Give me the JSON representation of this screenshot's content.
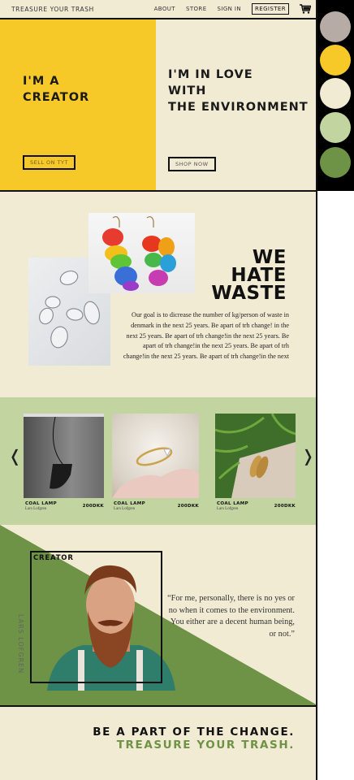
{
  "nav": {
    "brand": "TREASURE YOUR TRASH",
    "links": [
      "ABOUT",
      "STORE",
      "SIGN IN"
    ],
    "register": "REGISTER",
    "cart_icon": "cart-icon"
  },
  "hero": {
    "left": {
      "line1": "I'M A",
      "line2": "CREATOR",
      "button": "SELL ON TYT"
    },
    "right": {
      "line1": "I'M IN LOVE",
      "line2": "WITH",
      "line3": "THE ENVIRONMENT",
      "button": "SHOP NOW"
    }
  },
  "palette": {
    "colors": [
      "#b7aba5",
      "#f7c928",
      "#f2ebd4",
      "#c2d4a0",
      "#6e9246"
    ]
  },
  "about": {
    "title_1": "WE",
    "title_2": "HATE",
    "title_3": "WASTE",
    "text": "Our goal is to dicrease the number of kg/person of waste in denmark in the next 25 years. Be  apart of trh change! in the next 25 years. Be  apart of trh change!in the next 25 years. Be  apart of trh change!in the next 25 years. Be  apart of trh change!in the next 25 years. Be  apart of trh change!in the next"
  },
  "products": {
    "prev_icon": "chevron-left-icon",
    "next_icon": "chevron-right-icon",
    "items": [
      {
        "name": "COAL LAMP",
        "maker": "Lars Lofgren",
        "price": "200DKK"
      },
      {
        "name": "COAL LAMP",
        "maker": "Lars Lofgren",
        "price": "200DKK"
      },
      {
        "name": "COAL LAMP",
        "maker": "Lars Lofgren",
        "price": "200DKK"
      }
    ]
  },
  "creator": {
    "title": "CREATOR",
    "name_vertical": "LARS LOFGREN",
    "quote": "“For me, personally, there is no yes or no when it comes to the environment. You either are a decent human being, or not.”"
  },
  "cta": {
    "line1": "BE A PART OF THE CHANGE.",
    "line2": "TREASURE YOUR TRASH."
  }
}
